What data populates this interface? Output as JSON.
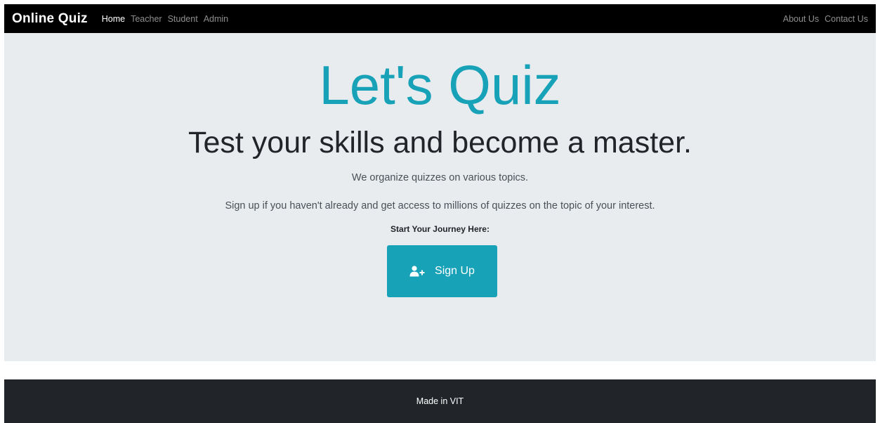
{
  "navbar": {
    "brand": "Online Quiz",
    "left_links": [
      {
        "label": "Home",
        "active": true
      },
      {
        "label": "Teacher",
        "active": false
      },
      {
        "label": "Student",
        "active": false
      },
      {
        "label": "Admin",
        "active": false
      }
    ],
    "right_links": [
      {
        "label": "About Us"
      },
      {
        "label": "Contact Us"
      }
    ]
  },
  "hero": {
    "title": "Let's Quiz",
    "subtitle": "Test your skills and become a master.",
    "lead_1": "We organize quizzes on various topics.",
    "lead_2": "Sign up if you haven't already and get access to millions of quizzes on the topic of your interest.",
    "journey_label": "Start Your Journey Here:",
    "signup_label": "Sign Up",
    "signup_icon": "user-plus-icon"
  },
  "footer": {
    "text": "Made in VIT"
  },
  "colors": {
    "accent": "#17a2b8",
    "navbar_bg": "#000000",
    "jumbotron_bg": "#e9ecef",
    "footer_bg": "#212529"
  }
}
